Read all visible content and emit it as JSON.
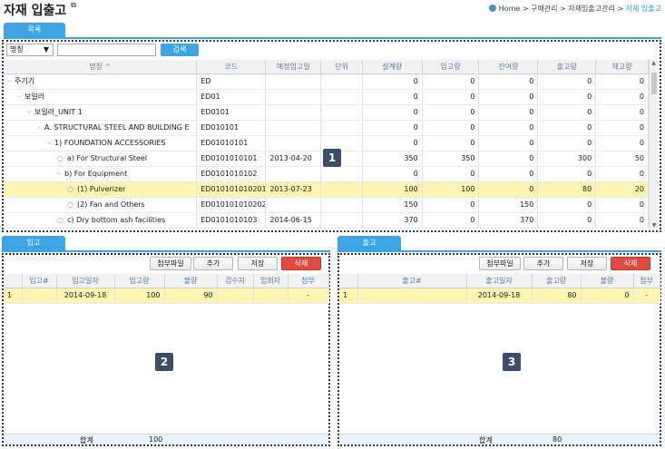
{
  "header": {
    "title": "자재 입출고",
    "breadcrumb": {
      "home": "Home",
      "sep": ">",
      "level1": "구매관리",
      "level2": "자재입출고관리",
      "current": "자재 입출고"
    }
  },
  "tabs": {
    "list": "목록",
    "in": "입고",
    "out": "출고"
  },
  "search": {
    "field": "명칭",
    "button": "검색"
  },
  "main_table": {
    "columns": [
      "명칭 ^",
      "코드",
      "예정입고일",
      "단위",
      "설계량",
      "입고량",
      "잔여량",
      "출고량",
      "재고량"
    ],
    "rows": [
      {
        "indent": 0,
        "prefix": "–",
        "name": "주기기",
        "code": "ED",
        "date": "",
        "unit": "",
        "v1": "0",
        "v2": "0",
        "v3": "0",
        "v4": "0",
        "v5": "0",
        "sel": false
      },
      {
        "indent": 1,
        "prefix": "–",
        "name": "보일러",
        "code": "ED01",
        "date": "",
        "unit": "",
        "v1": "0",
        "v2": "0",
        "v3": "0",
        "v4": "0",
        "v5": "0",
        "sel": false
      },
      {
        "indent": 2,
        "prefix": "–",
        "name": "보일러_UNIT 1",
        "code": "ED0101",
        "date": "",
        "unit": "",
        "v1": "0",
        "v2": "0",
        "v3": "0",
        "v4": "0",
        "v5": "0",
        "sel": false
      },
      {
        "indent": 3,
        "prefix": "–",
        "name": "A. STRUCTURAL STEEL AND BUILDING E",
        "code": "ED010101",
        "date": "",
        "unit": "",
        "v1": "0",
        "v2": "0",
        "v3": "0",
        "v4": "0",
        "v5": "0",
        "sel": false
      },
      {
        "indent": 4,
        "prefix": "–",
        "name": "1) FOUNDATION ACCESSORIES",
        "code": "ED01010101",
        "date": "",
        "unit": "",
        "v1": "0",
        "v2": "0",
        "v3": "0",
        "v4": "0",
        "v5": "0",
        "sel": false
      },
      {
        "indent": 5,
        "prefix": "○",
        "name": "a) For Structural Steel",
        "code": "ED0101010101",
        "date": "2013-04-20",
        "unit": "",
        "v1": "350",
        "v2": "350",
        "v3": "0",
        "v4": "300",
        "v5": "50",
        "sel": false
      },
      {
        "indent": 5,
        "prefix": "–",
        "name": "b) For Equipment",
        "code": "ED0101010102",
        "date": "",
        "unit": "",
        "v1": "0",
        "v2": "0",
        "v3": "0",
        "v4": "0",
        "v5": "0",
        "sel": false
      },
      {
        "indent": 6,
        "prefix": "○",
        "name": "(1) Pulverizer",
        "code": "ED010101010201",
        "date": "2013-07-23",
        "unit": "",
        "v1": "100",
        "v2": "100",
        "v3": "0",
        "v4": "80",
        "v5": "20",
        "sel": true
      },
      {
        "indent": 6,
        "prefix": "○",
        "name": "(2) Fan and Others",
        "code": "ED010101010202",
        "date": "",
        "unit": "",
        "v1": "150",
        "v2": "0",
        "v3": "150",
        "v4": "0",
        "v5": "0",
        "sel": false
      },
      {
        "indent": 5,
        "prefix": "○",
        "name": "c) Dry bottom ash facilities",
        "code": "ED0101010103",
        "date": "2014-06-15",
        "unit": "",
        "v1": "370",
        "v2": "0",
        "v3": "370",
        "v4": "0",
        "v5": "0",
        "sel": false
      }
    ]
  },
  "in_panel": {
    "buttons": {
      "attach": "첨부파일",
      "add": "추가",
      "save": "저장",
      "delete": "삭제"
    },
    "columns": [
      "",
      "입고#",
      "입고일자",
      "입고량",
      "불량",
      "검수자",
      "입회자",
      "첨부"
    ],
    "rows": [
      {
        "no": "1",
        "id": "",
        "date": "2014-09-18",
        "qty": "100",
        "bad": "90",
        "inspector": "",
        "witness": "",
        "attach": "-"
      }
    ],
    "footer": {
      "label": "합계",
      "total": "100"
    }
  },
  "out_panel": {
    "buttons": {
      "attach": "첨부파일",
      "add": "추가",
      "save": "저장",
      "delete": "삭제"
    },
    "columns": [
      "",
      "출고#",
      "출고일자",
      "출고량",
      "불량",
      "첨부"
    ],
    "rows": [
      {
        "no": "1",
        "id": "",
        "date": "2014-09-18",
        "qty": "80",
        "bad": "0",
        "attach": "-"
      }
    ],
    "footer": {
      "label": "합계",
      "total": "80"
    }
  },
  "markers": {
    "m1": "1",
    "m2": "2",
    "m3": "3"
  },
  "colors": {
    "accent": "#3da5e3",
    "delete": "#e04a3f",
    "selected_row": "#fff4b0",
    "marker": "#3a4e6b"
  }
}
